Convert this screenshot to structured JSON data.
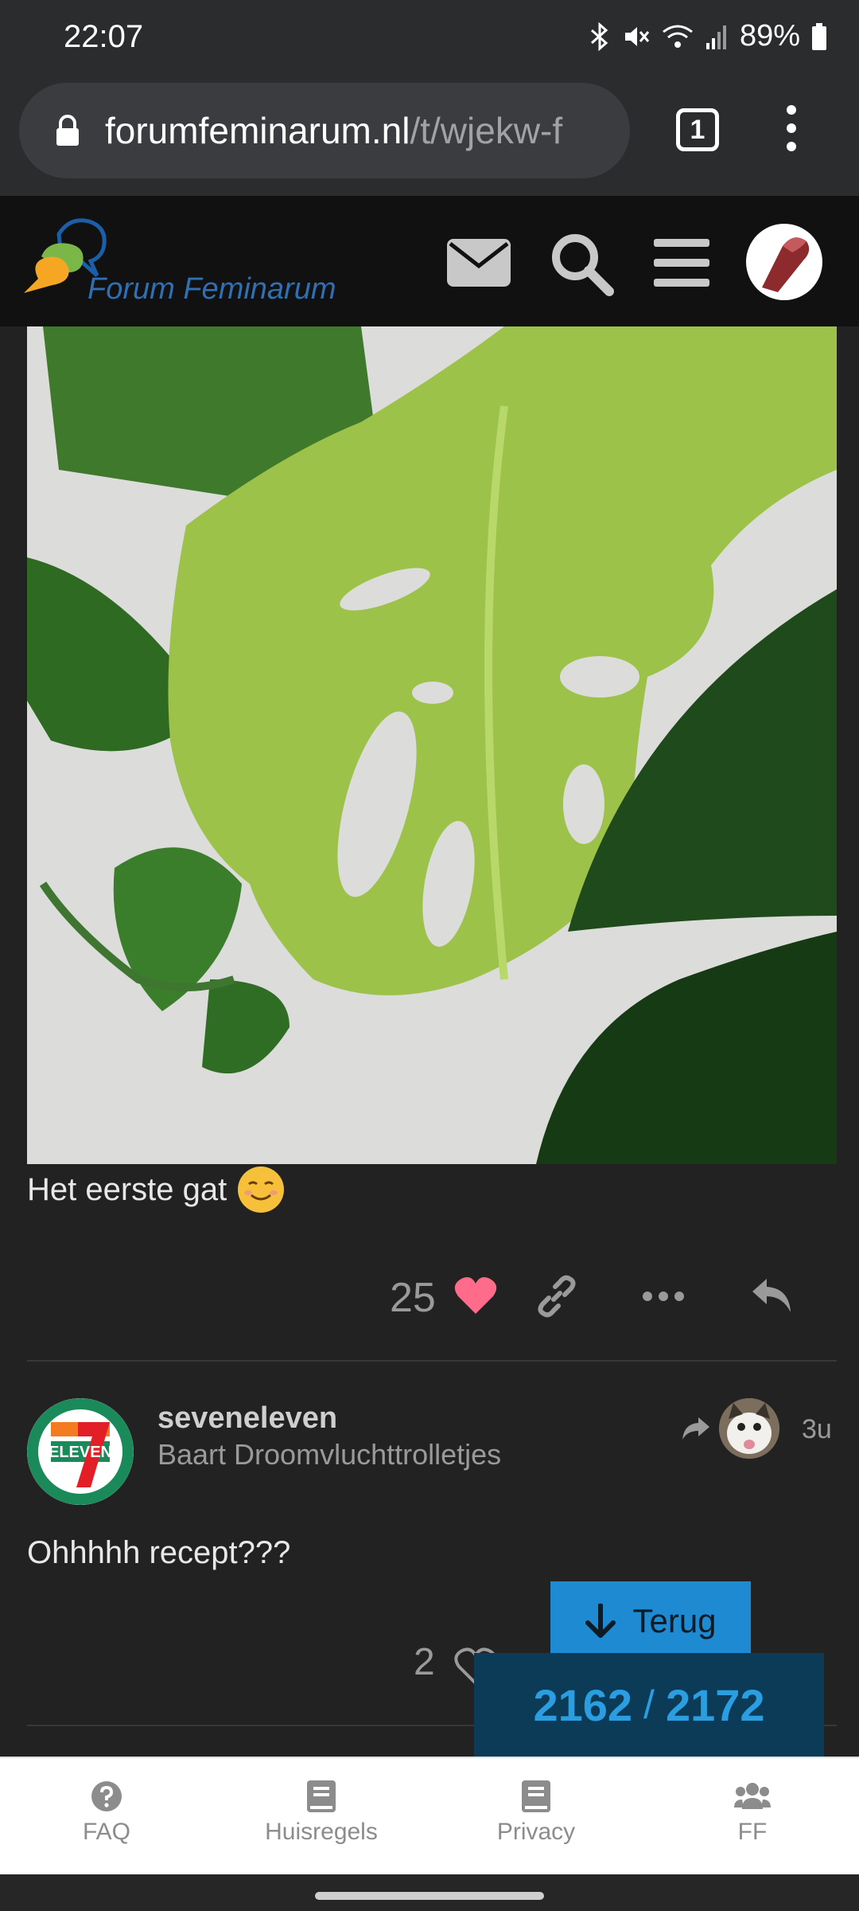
{
  "status_bar": {
    "time": "22:07",
    "battery": "89%"
  },
  "browser": {
    "url_domain": "forumfeminarum.nl",
    "url_path": "/t/wjekw-f",
    "tab_count": "1"
  },
  "site": {
    "name": "Forum Feminarum"
  },
  "post1": {
    "text": "Het eerste gat",
    "like_count": "25"
  },
  "post2": {
    "username": "seveneleven",
    "user_title": "Baart Droomvluchttrolletjes",
    "time_ago": "3u",
    "text": "Ohhhhh recept???",
    "like_count": "2",
    "avatar_label": "ELEVEN",
    "avatar_number": "7"
  },
  "back_button": {
    "label": "Terug"
  },
  "timeline": {
    "current": "2162",
    "separator": "/",
    "total": "2172"
  },
  "bottom_nav": [
    {
      "label": "FAQ",
      "icon": "question-circle-icon"
    },
    {
      "label": "Huisregels",
      "icon": "book-icon"
    },
    {
      "label": "Privacy",
      "icon": "book-icon"
    },
    {
      "label": "FF",
      "icon": "users-icon"
    }
  ],
  "colors": {
    "like_heart": "#ff6b8b",
    "accent": "#1d8ad1",
    "timeline_bg": "#0b3b57"
  }
}
